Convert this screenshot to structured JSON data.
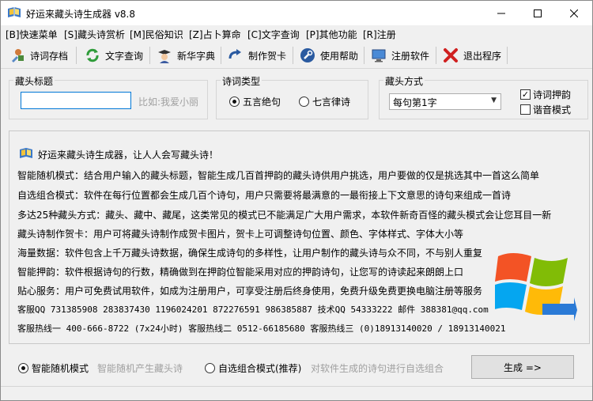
{
  "window": {
    "title": "好运来藏头诗生成器 v8.8",
    "icon": "app-book-icon"
  },
  "menubar": {
    "items": [
      {
        "label": "[B]快速菜单"
      },
      {
        "label": "[S]藏头诗赏析"
      },
      {
        "label": "[M]民俗知识"
      },
      {
        "label": "[Z]占卜算命"
      },
      {
        "label": "[C]文字查询"
      },
      {
        "label": "[P]其他功能"
      },
      {
        "label": "[R]注册"
      }
    ]
  },
  "toolbar": {
    "buttons": [
      {
        "label": "诗词存档",
        "icon": "save-icon"
      },
      {
        "label": "文字查询",
        "icon": "refresh-icon"
      },
      {
        "label": "新华字典",
        "icon": "scholar-icon"
      },
      {
        "label": "制作贺卡",
        "icon": "redo-icon"
      },
      {
        "label": "使用帮助",
        "icon": "wrench-icon"
      },
      {
        "label": "注册软件",
        "icon": "monitor-icon"
      },
      {
        "label": "退出程序",
        "icon": "exit-x-icon"
      }
    ]
  },
  "form": {
    "title_group_label": "藏头标题",
    "title_input_value": "",
    "title_placeholder": "比如:我爱小丽",
    "type_group_label": "诗词类型",
    "type_options": [
      "五言绝句",
      "七言律诗"
    ],
    "type_selected": "五言绝句",
    "method_group_label": "藏头方式",
    "method_selected": "每句第1字",
    "checkboxes": [
      {
        "label": "诗词押韵",
        "checked": true
      },
      {
        "label": "谐音模式",
        "checked": false
      }
    ]
  },
  "info": {
    "headline": "好运来藏头诗生成器，让人人会写藏头诗！",
    "lines": [
      "智能随机模式：结合用户输入的藏头标题，智能生成几百首押韵的藏头诗供用户挑选，用户要做的仅是挑选其中一首这么简单",
      "自选组合模式：软件在每行位置都会生成几百个诗句，用户只需要将最满意的一最衔接上下文意思的诗句来组成一首诗",
      "多达25种藏头方式：藏头、藏中、藏尾，这类常见的模式已不能满足广大用户需求，本软件新奇百怪的藏头模式会让您耳目一新",
      "藏头诗制作贺卡：用户可将藏头诗制作成贺卡图片，贺卡上可调整诗句位置、颜色、字体样式、字体大小等",
      "海量数据：软件包含上千万藏头诗数据，确保生成诗句的多样性，让用户制作的藏头诗与众不同，不与别人重复",
      "智能押韵：软件根据诗句的行数，精确做到在押韵位智能采用对应的押韵诗句，让您写的诗读起来朗朗上口",
      "贴心服务：用户可免费试用软件，如成为注册用户，可享受注册后终身使用，免费升级免费更换电脑注册等服务"
    ],
    "contact_line_1": "客服QQ 731385908  283837430  1196024201  872276591  986385887  技术QQ 54333222  邮件 388381@qq.com",
    "contact_line_2": "客服热线一 400-666-8722 (7x24小时)  客服热线二 0512-66185680  客服热线三 (0)18913140020 / 18913140021",
    "logo": "windows-flag-logo"
  },
  "bottom": {
    "mode_options": [
      {
        "label": "智能随机模式",
        "hint": "智能随机产生藏头诗",
        "checked": true
      },
      {
        "label": "自选组合模式(推荐)",
        "hint": "对软件生成的诗句进行自选组合",
        "checked": false
      }
    ],
    "generate_label": "生成 =>"
  }
}
